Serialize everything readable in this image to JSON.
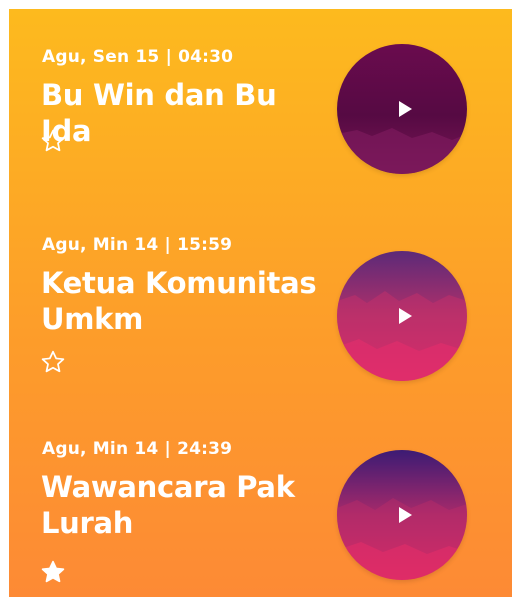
{
  "episodes": [
    {
      "meta": "Agu, Sen 15 | 04:30",
      "title": "Bu Win dan Bu Ida",
      "favorite": false,
      "star_icon": "star-outline-icon",
      "thumb_colors": [
        "#6a0b4e",
        "#4f0a3e",
        "#7a1656"
      ]
    },
    {
      "meta": "Agu, Min 14 | 15:59",
      "title": "Ketua Komunitas Umkm",
      "favorite": false,
      "star_icon": "star-outline-icon",
      "thumb_colors": [
        "#6a2a79",
        "#b0306a",
        "#e02a6a"
      ]
    },
    {
      "meta": "Agu, Min 14 | 24:39",
      "title": "Wawancara Pak Lurah",
      "favorite": true,
      "star_icon": "star-filled-icon",
      "thumb_colors": [
        "#3c1b74",
        "#a82a6a",
        "#e22a66"
      ]
    }
  ],
  "colors": {
    "background_top": "#fdba1e",
    "background_bottom": "#fd8a35",
    "text": "#ffffff"
  },
  "play_icon": "play-icon"
}
